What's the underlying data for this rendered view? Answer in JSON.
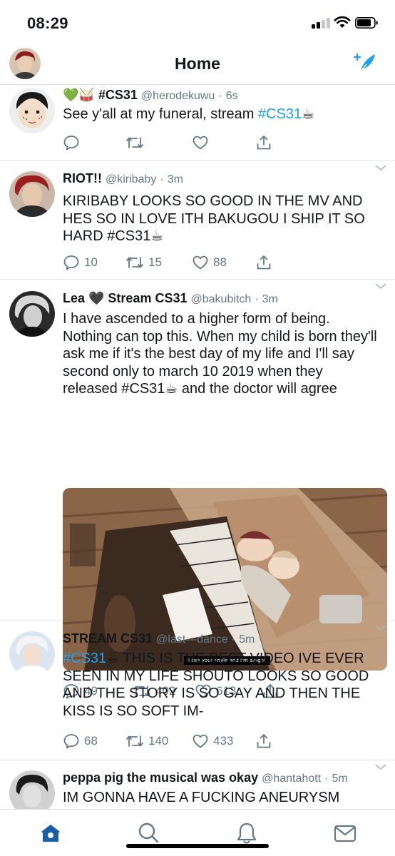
{
  "status_bar": {
    "time": "08:29"
  },
  "header": {
    "title": "Home"
  },
  "tweets": [
    {
      "emoji": "💚🥁",
      "name": "#CS31",
      "handle": "@herodekuwu",
      "time": "6s",
      "text_prefix": "See y'all at my funeral, stream ",
      "hashtag": "#CS31",
      "coffee": "☕",
      "replies": "",
      "retweets": "",
      "likes": ""
    },
    {
      "name": "RIOT!!",
      "handle": "@kiribaby",
      "time": "3m",
      "text": "KIRIBABY LOOKS SO GOOD IN THE MV AND HES SO IN LOVE ITH BAKUGOU I SHIP IT SO HARD #CS31☕",
      "replies": "10",
      "retweets": "15",
      "likes": "88"
    },
    {
      "name": "Lea 🖤 Stream CS31",
      "handle": "@bakubitch",
      "time": "3m",
      "text": "I have ascended to a higher form of being. Nothing can top this. When my child is born they'll ask me if it's the best day of my life and I'll say second only to march 10 2019 when they released #CS31☕ and the doctor will agree",
      "media_caption": "I see your smile and I'm alright",
      "replies": "49",
      "retweets": "402",
      "likes": "613"
    },
    {
      "name": "STREAM CS31",
      "handle": "@last—dance",
      "time": "5m",
      "hashtag": "#CS31",
      "coffee": "☕",
      "text_suffix": " THIS IS THE BEST VIDEO IVE EVER SEEN IN MY LIFE SHOUTO LOOKS SO GOOD AND THE STORY IS SO GAY AND THEN THE KISS IS SO SOFT IM-",
      "replies": "68",
      "retweets": "140",
      "likes": "433"
    },
    {
      "name": "peppa pig the musical was okay",
      "handle": "@hantahott",
      "time": "5m",
      "text": "IM GONNA HAVE A FUCKING ANEURYSM"
    }
  ],
  "icons": {
    "reply": "reply-icon",
    "retweet": "retweet-icon",
    "like": "heart-icon",
    "share": "share-icon",
    "home": "home-icon",
    "search": "search-icon",
    "notifications": "bell-icon",
    "messages": "mail-icon",
    "compose": "compose-icon"
  },
  "colors": {
    "accent": "#1da1f2",
    "active_tab": "#1b5fa8",
    "secondary_text": "#657786",
    "divider": "#e1e8ed"
  }
}
